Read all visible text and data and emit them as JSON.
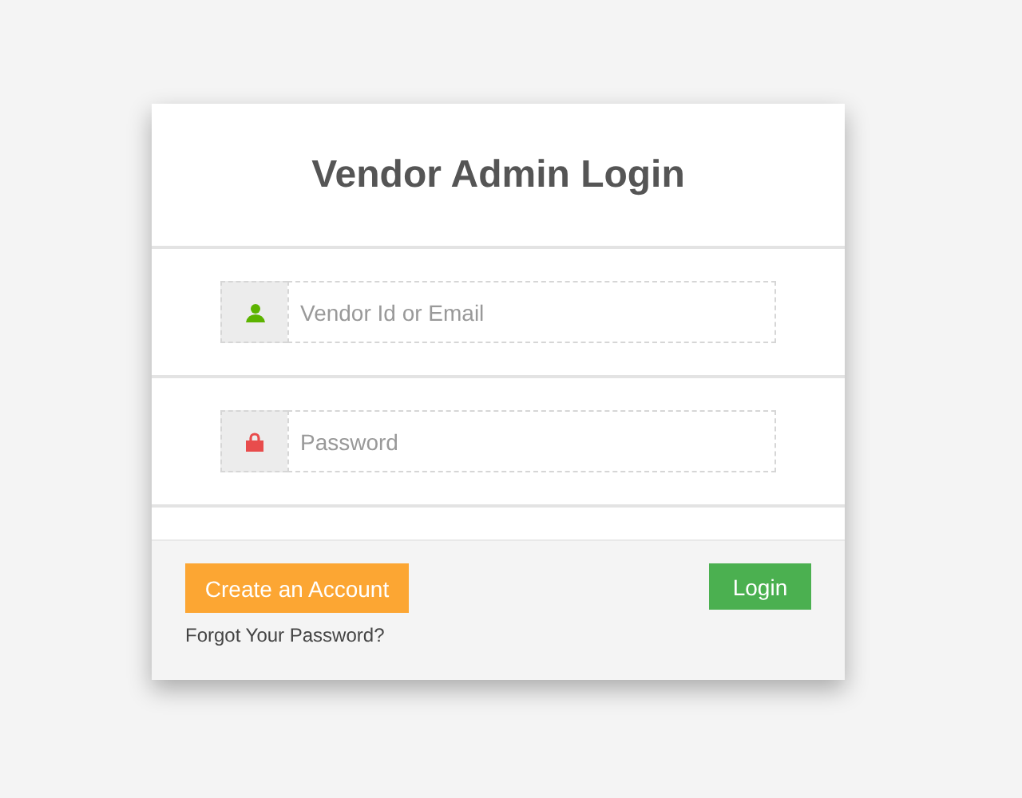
{
  "title": "Vendor Admin Login",
  "fields": [
    {
      "kind": "user",
      "placeholder": "Vendor Id or Email"
    },
    {
      "kind": "password",
      "placeholder": "Password"
    }
  ],
  "buttons": [
    {
      "kind": "create",
      "label": "Create an Account"
    },
    {
      "kind": "login",
      "label": "Login"
    }
  ],
  "forgot_link": "Forgot Your Password?"
}
